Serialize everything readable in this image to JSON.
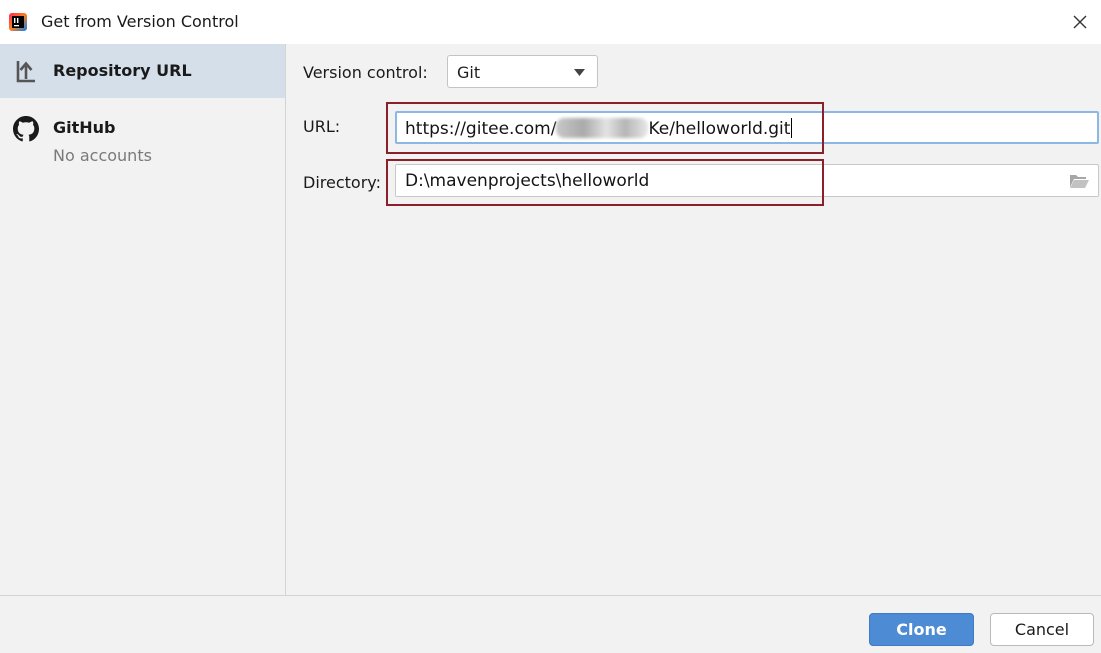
{
  "window": {
    "title": "Get from Version Control",
    "app_icon": "intellij-idea-icon",
    "close_icon": "close-icon"
  },
  "sidebar": {
    "items": [
      {
        "label": "Repository URL",
        "icon": "repository-url-icon",
        "selected": true
      },
      {
        "label": "GitHub",
        "sublabel": "No accounts",
        "icon": "github-icon",
        "selected": false
      }
    ]
  },
  "form": {
    "version_control_label": "Version control:",
    "version_control_value": "Git",
    "url_label": "URL:",
    "url_value_prefix": "https://gitee.com/",
    "url_value_suffix": "Ke/helloworld.git",
    "directory_label": "Directory:",
    "directory_value": "D:\\mavenprojects\\helloworld"
  },
  "footer": {
    "clone_label": "Clone",
    "cancel_label": "Cancel"
  },
  "colors": {
    "primary_button": "#4d8bd5",
    "selection": "#d5dfea",
    "annotation_box": "#8b1f2a",
    "focus_border": "#8db8e6"
  }
}
